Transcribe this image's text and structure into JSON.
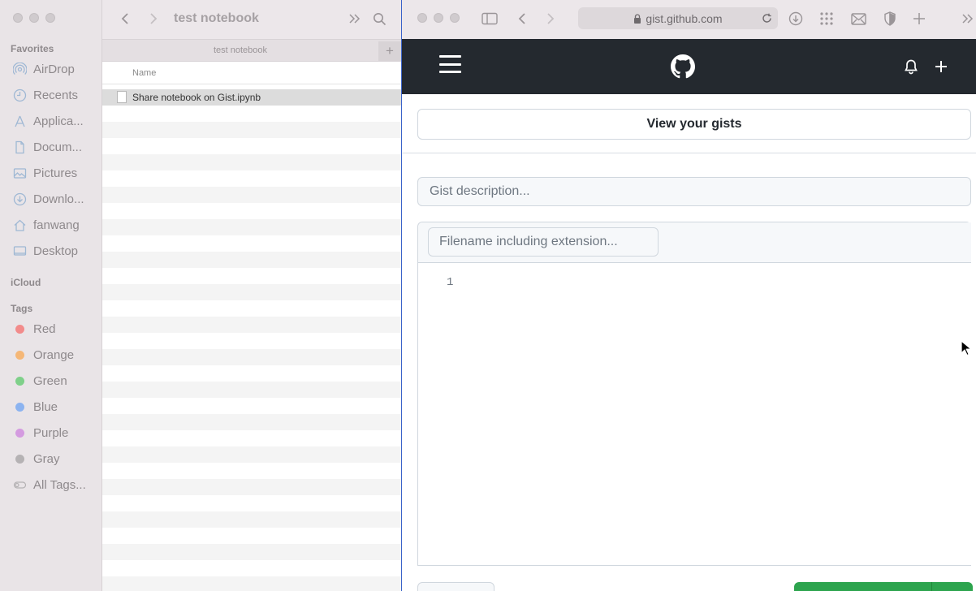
{
  "finder": {
    "sidebar": {
      "favorites_label": "Favorites",
      "favorites": [
        {
          "label": "AirDrop",
          "icon": "airdrop-icon"
        },
        {
          "label": "Recents",
          "icon": "clock-icon"
        },
        {
          "label": "Applica...",
          "icon": "applications-icon"
        },
        {
          "label": "Docum...",
          "icon": "document-icon"
        },
        {
          "label": "Pictures",
          "icon": "photo-icon"
        },
        {
          "label": "Downlo...",
          "icon": "download-icon"
        },
        {
          "label": "fanwang",
          "icon": "home-icon"
        },
        {
          "label": "Desktop",
          "icon": "desktop-icon"
        }
      ],
      "icloud_label": "iCloud",
      "tags_label": "Tags",
      "tags": [
        {
          "label": "Red",
          "color": "#f28b8b"
        },
        {
          "label": "Orange",
          "color": "#f5b777"
        },
        {
          "label": "Green",
          "color": "#7fd08a"
        },
        {
          "label": "Blue",
          "color": "#8cb3f0"
        },
        {
          "label": "Purple",
          "color": "#d49be0"
        },
        {
          "label": "Gray",
          "color": "#b5b2b4"
        },
        {
          "label": "All Tags...",
          "color": ""
        }
      ]
    },
    "title": "test notebook",
    "tab_label": "test notebook",
    "column_name": "Name",
    "files": [
      "Share notebook on Gist.ipynb"
    ]
  },
  "safari": {
    "address": "gist.github.com"
  },
  "gist": {
    "view_gists_label": "View your gists",
    "description_placeholder": "Gist description...",
    "filename_placeholder": "Filename including extension...",
    "line_number": "1"
  }
}
